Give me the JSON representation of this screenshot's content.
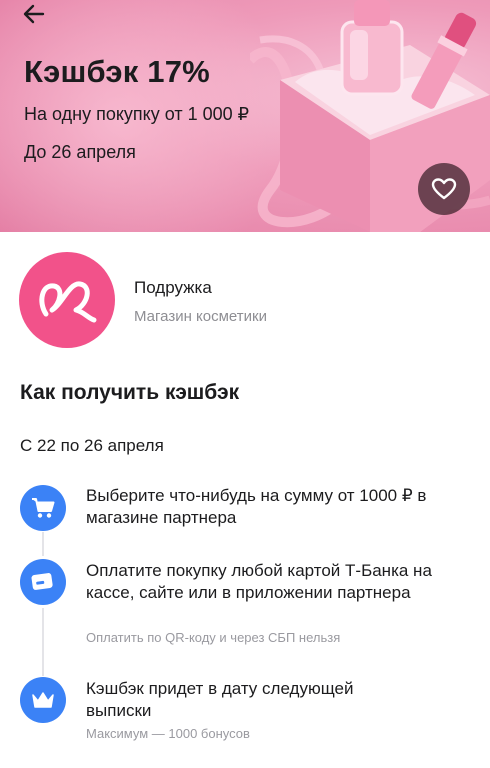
{
  "banner": {
    "title": "Кэшбэк 17%",
    "subtitle": "На одну покупку от 1 000 ₽",
    "deadline": "До 26 апреля"
  },
  "partner": {
    "name": "Подружка",
    "description": "Магазин косметики"
  },
  "how_to": {
    "title": "Как получить кэшбэк",
    "period": "С 22 по 26 апреля",
    "steps": [
      {
        "text": "Выберите что-нибудь на сумму от 1000 ₽ в магазине партнера",
        "icon": "cart-icon"
      },
      {
        "text": "Оплатите покупку любой картой Т-Банка на кассе, сайте или в приложении партнера",
        "note": "Оплатить по QR-коду и через СБП нельзя",
        "icon": "card-icon"
      },
      {
        "text": "Кэшбэк придет в дату следующей выписки",
        "note": "Максимум — 1000 бонусов",
        "icon": "crown-icon"
      }
    ]
  },
  "colors": {
    "accent_blue": "#3b82f6",
    "partner_pink": "#f2528a",
    "banner_pink": "#ee9ab9"
  }
}
